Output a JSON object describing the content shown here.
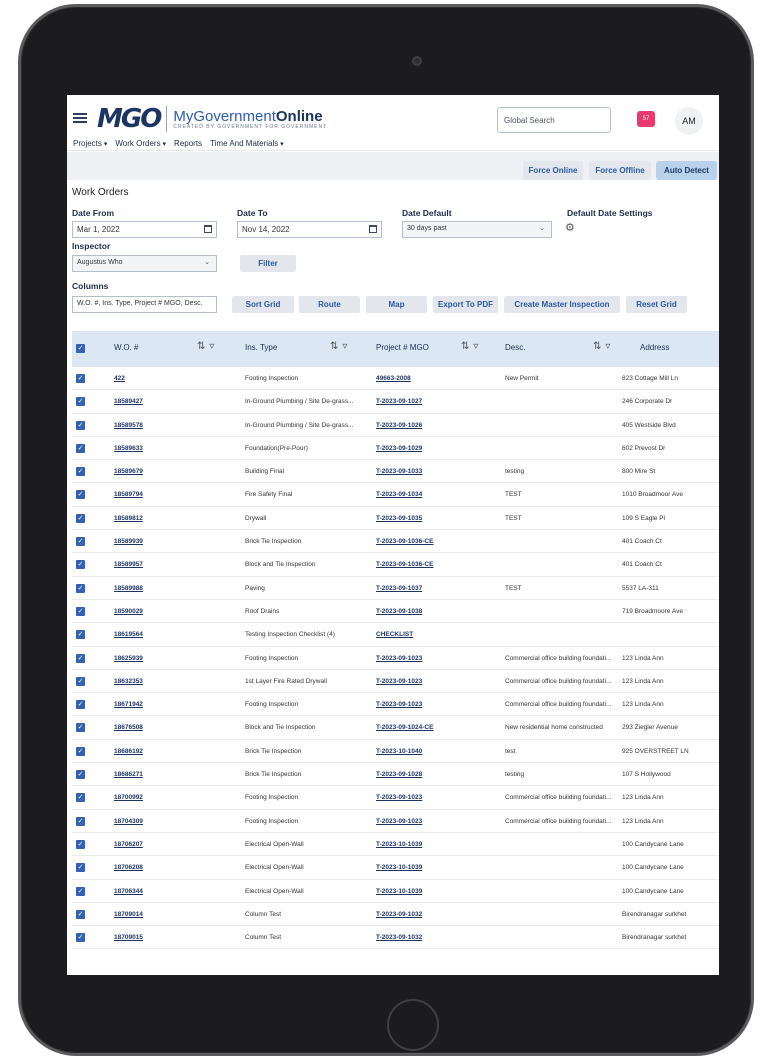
{
  "header": {
    "logo_mark": "MGO",
    "logo_title_light": "MyGovernment",
    "logo_title_bold": "Online",
    "logo_tagline": "CREATED BY GOVERNMENT FOR GOVERNMENT",
    "nav": [
      "Projects",
      "Work Orders",
      "Reports",
      "Time And Materials"
    ],
    "search_placeholder": "Global Search",
    "notif_count": "57",
    "avatar": "AM"
  },
  "force_buttons": [
    "Force Online",
    "Force Offline",
    "Auto Detect"
  ],
  "page_title": "Work Orders",
  "form": {
    "date_from_label": "Date From",
    "date_from_value": "Mar 1, 2022",
    "date_to_label": "Date To",
    "date_to_value": "Nov 14, 2022",
    "date_default_label": "Date Default",
    "date_default_value": "30 days past",
    "default_date_settings_label": "Default Date Settings",
    "inspector_label": "Inspector",
    "inspector_value": "Augustus Who",
    "filter_button": "Filter",
    "columns_label": "Columns",
    "columns_value": "W.O. #, Ins. Type, Project # MGO, Desc.",
    "buttons": [
      "Sort Grid",
      "Route",
      "Map",
      "Export To PDF",
      "Create Master Inspection",
      "Reset Grid"
    ]
  },
  "grid": {
    "columns": [
      "W.O. #",
      "Ins. Type",
      "Project # MGO",
      "Desc.",
      "Address"
    ],
    "rows": [
      [
        "422",
        "Footing Inspection",
        "49663-2008",
        "New Permit",
        "823 Cottage Mill Ln"
      ],
      [
        "18589427",
        "In-Ground Plumbing / Site De-grass...",
        "T-2023-09-1027",
        "",
        "246 Corporate Dr"
      ],
      [
        "18589578",
        "In-Ground Plumbing / Site De-grass...",
        "T-2023-09-1026",
        "",
        "405 Westside Blvd"
      ],
      [
        "18589633",
        "Foundation(Pre-Pour)",
        "T-2023-09-1029",
        "",
        "602 Prevost Dr"
      ],
      [
        "18589679",
        "Building Final",
        "T-2023-09-1033",
        "testing",
        "800 Mire St"
      ],
      [
        "18589794",
        "Fire Safety Final",
        "T-2023-09-1034",
        "TEST",
        "1010 Broadmoor Ave"
      ],
      [
        "18589812",
        "Drywall",
        "T-2023-09-1035",
        "TEST",
        "109 S Eagle Pl"
      ],
      [
        "18589939",
        "Brick Tie Inspection",
        "T-2023-09-1036-CE",
        "",
        "401 Coach Ct"
      ],
      [
        "18589957",
        "Block and Tie Inspection",
        "T-2023-09-1036-CE",
        "",
        "401 Coach Ct"
      ],
      [
        "18589988",
        "Paving",
        "T-2023-09-1037",
        "TEST",
        "5537 LA-311"
      ],
      [
        "18590029",
        "Roof Drains",
        "T-2023-09-1038",
        "",
        "719 Broadmoore Ave"
      ],
      [
        "18619564",
        "Testing Inspection Checklist (4)",
        "CHECKLIST",
        "",
        ""
      ],
      [
        "18625939",
        "Footing Inspection",
        "T-2023-09-1023",
        "Commercial office building foundati...",
        "123 Linda Ann"
      ],
      [
        "18632353",
        "1st Layer Fire Rated Drywall",
        "T-2023-09-1023",
        "Commercial office building foundati...",
        "123 Linda Ann"
      ],
      [
        "18671942",
        "Footing Inspection",
        "T-2023-09-1023",
        "Commercial office building foundati...",
        "123 Linda Ann"
      ],
      [
        "18676508",
        "Block and Tie Inspection",
        "T-2023-09-1024-CE",
        "New residential home constructed",
        "293 Ziegler Avenue"
      ],
      [
        "18686192",
        "Brick Tie Inspection",
        "T-2023-10-1040",
        "test",
        "925 OVERSTREET LN"
      ],
      [
        "18686271",
        "Brick Tie Inspection",
        "T-2023-09-1028",
        "testing",
        "107 S Hollywood"
      ],
      [
        "18700992",
        "Footing Inspection",
        "T-2023-09-1023",
        "Commercial office building foundati...",
        "123 Linda Ann"
      ],
      [
        "18704309",
        "Footing Inspection",
        "T-2023-09-1023",
        "Commercial office building foundati...",
        "123 Linda Ann"
      ],
      [
        "18706207",
        "Electrical Open-Wall",
        "T-2023-10-1039",
        "",
        "100 Candycane Lane"
      ],
      [
        "18706208",
        "Electrical Open-Wall",
        "T-2023-10-1039",
        "",
        "100 Candycane Lane"
      ],
      [
        "18706344",
        "Electrical Open-Wall",
        "T-2023-10-1039",
        "",
        "100 Candycane Lane"
      ],
      [
        "18709014",
        "Column Test",
        "T-2023-09-1032",
        "",
        "Birendranagar surkhet"
      ],
      [
        "18709015",
        "Column Test",
        "T-2023-09-1032",
        "",
        "Birendranagar surkhet"
      ]
    ]
  }
}
